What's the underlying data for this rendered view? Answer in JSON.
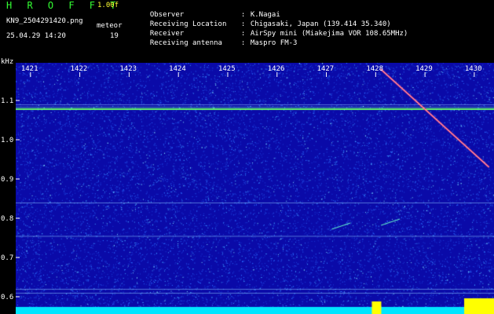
{
  "header": {
    "brand": "H R O F F T",
    "version": "1.00f",
    "filename": "KN9_2504291420.png",
    "meteor_label": "meteor",
    "datetime": "25.04.29 14:20",
    "meteor_count": "19"
  },
  "info": [
    {
      "key": "Observer",
      "value": "K.Nagai"
    },
    {
      "key": "Receiving Location",
      "value": "Chigasaki, Japan (139.414 35.340)"
    },
    {
      "key": "Receiver",
      "value": "AirSpy mini (Miakejima VOR 108.65MHz)"
    },
    {
      "key": "Receiving antenna",
      "value": "Maspro FM-3"
    }
  ],
  "chart_data": {
    "type": "heatmap",
    "yunit": "kHz",
    "x_ticks": [
      "1421",
      "1422",
      "1423",
      "1424",
      "1425",
      "1426",
      "1427",
      "1428",
      "1429",
      "1430"
    ],
    "y_ticks": [
      "1.1",
      "1.0",
      "0.9",
      "0.8",
      "0.7",
      "0.6"
    ],
    "ylim": [
      0.58,
      1.18
    ],
    "carrier_khz": 1.08,
    "extra_lines_khz": [
      1.09,
      0.84,
      0.755,
      0.62,
      0.61
    ],
    "doppler_trace": {
      "x_start_min": 1428.1,
      "y_start_khz": 1.18,
      "x_end_min": 1430.3,
      "y_end_khz": 0.93
    },
    "meteor_echoes": [
      {
        "x_min": 1427.3,
        "y_khz": 0.78
      },
      {
        "x_min": 1428.3,
        "y_khz": 0.79
      }
    ],
    "colors": {
      "background": "#0a0aa8",
      "noise": "#2a6cff",
      "carrier": "#66ff66",
      "trace": "#ff4466",
      "baseline": "#00e5ff",
      "burst": "#ffff00"
    }
  }
}
